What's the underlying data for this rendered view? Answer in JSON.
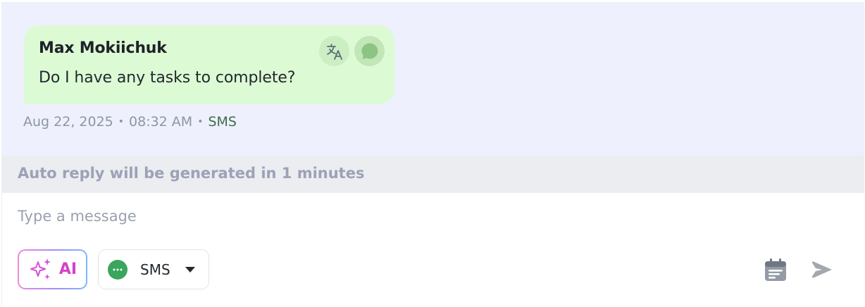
{
  "message": {
    "sender": "Max Mokiichuk",
    "text": "Do I have any tasks to complete?",
    "date": "Aug 22, 2025",
    "time": "08:32 AM",
    "separator": "•",
    "channel": "SMS",
    "actions": [
      {
        "icon": "translate-icon"
      },
      {
        "icon": "chat-bubble-icon"
      }
    ]
  },
  "auto_reply": {
    "text": "Auto reply will be generated in 1 minutes"
  },
  "composer": {
    "placeholder": "Type a message",
    "ai_label": "AI",
    "channel_select": {
      "selected": "SMS",
      "icon": "sms-icon"
    },
    "schedule_icon": "calendar-icon",
    "send_icon": "send-icon"
  },
  "colors": {
    "chat_background": "#eef0fd",
    "bubble": "#dcfbd4",
    "auto_reply_background": "#ecedf0",
    "ai_accent": "#d641c9",
    "sms_green": "#3aa55c",
    "channel_text": "#3f6f48"
  }
}
